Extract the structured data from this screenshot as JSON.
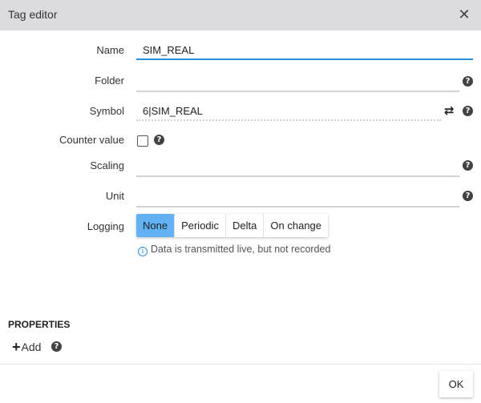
{
  "dialog": {
    "title": "Tag editor",
    "close_icon": "close-icon"
  },
  "form": {
    "name": {
      "label": "Name",
      "value": "SIM_REAL"
    },
    "folder": {
      "label": "Folder",
      "value": ""
    },
    "symbol": {
      "label": "Symbol",
      "value": "6|SIM_REAL"
    },
    "counter_value": {
      "label": "Counter value",
      "checked": false
    },
    "scaling": {
      "label": "Scaling",
      "value": ""
    },
    "unit": {
      "label": "Unit",
      "value": ""
    },
    "logging": {
      "label": "Logging",
      "options": [
        "None",
        "Periodic",
        "Delta",
        "On change"
      ],
      "selected": "None",
      "info": "Data is transmitted live, but not recorded"
    }
  },
  "properties": {
    "title": "PROPERTIES",
    "add_label": "Add"
  },
  "footer": {
    "ok_label": "OK"
  },
  "colors": {
    "accent": "#2b8fe0",
    "selected_segment": "#61b1f4",
    "titlebar": "#dcdbe0"
  }
}
